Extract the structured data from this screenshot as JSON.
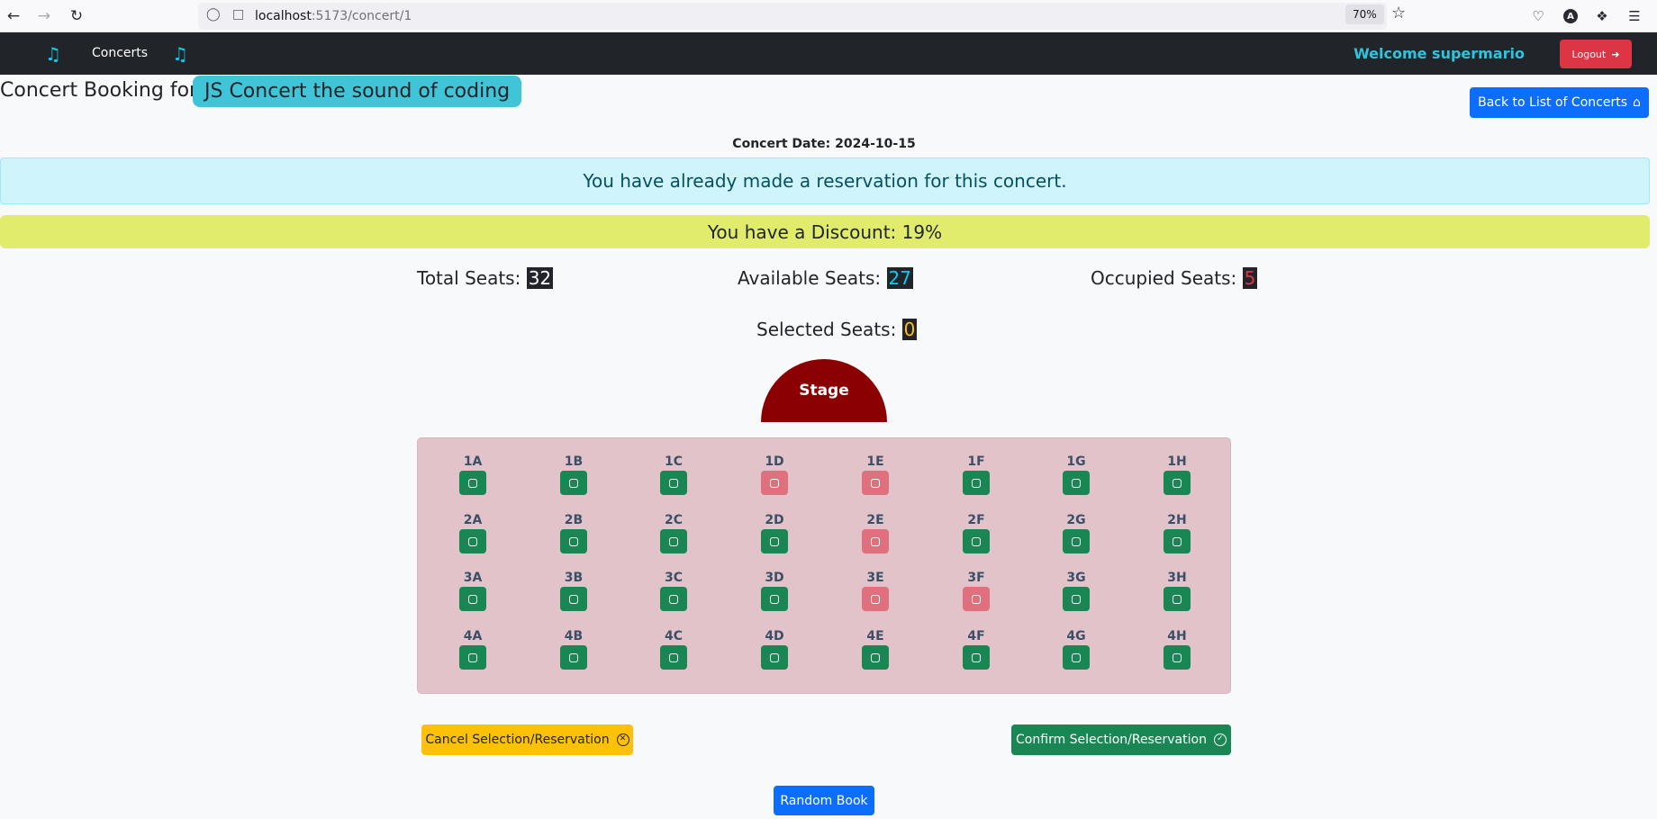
{
  "browser": {
    "url_host": "localhost",
    "url_path": ":5173/concert/1",
    "zoom": "70%",
    "account_initial": "A"
  },
  "navbar": {
    "concerts_link": "Concerts",
    "welcome_text": "Welcome supermario",
    "logout_label": "Logout"
  },
  "header": {
    "booking_label": "Concert Booking for:",
    "concert_name": "JS Concert the sound of coding",
    "back_button": "Back to List of Concerts",
    "concert_date": "Concert Date: 2024-10-15"
  },
  "alerts": {
    "reservation_notice": "You have already made a reservation for this concert.",
    "discount_notice": "You have a Discount: 19%"
  },
  "stats": {
    "total_label": "Total Seats:",
    "total_value": "32",
    "available_label": "Available Seats:",
    "available_value": "27",
    "occupied_label": "Occupied Seats:",
    "occupied_value": "5",
    "selected_label": "Selected Seats:",
    "selected_value": "0"
  },
  "stage_label": "Stage",
  "seats": {
    "rows": [
      "1",
      "2",
      "3",
      "4"
    ],
    "columns": [
      "A",
      "B",
      "C",
      "D",
      "E",
      "F",
      "G",
      "H"
    ],
    "occupied": [
      "1D",
      "1E",
      "2E",
      "3E",
      "3F"
    ]
  },
  "actions": {
    "cancel_label": "Cancel Selection/Reservation",
    "confirm_label": "Confirm Selection/Reservation",
    "random_label": "Random Book"
  },
  "colors": {
    "free_seat": "#198754",
    "occupied_seat": "#e0707d",
    "stage": "#8b0000",
    "seat_map_bg": "#e3c3ca"
  }
}
